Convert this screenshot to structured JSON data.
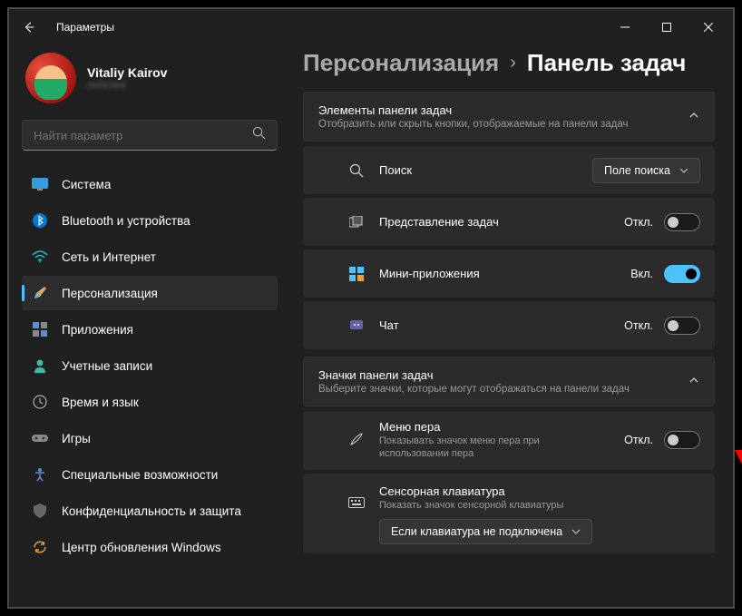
{
  "window": {
    "title": "Параметры"
  },
  "user": {
    "name": "Vitaliy Kairov",
    "email": "redacted"
  },
  "search": {
    "placeholder": "Найти параметр"
  },
  "nav": [
    {
      "label": "Система"
    },
    {
      "label": "Bluetooth и устройства"
    },
    {
      "label": "Сеть и Интернет"
    },
    {
      "label": "Персонализация"
    },
    {
      "label": "Приложения"
    },
    {
      "label": "Учетные записи"
    },
    {
      "label": "Время и язык"
    },
    {
      "label": "Игры"
    },
    {
      "label": "Специальные возможности"
    },
    {
      "label": "Конфиденциальность и защита"
    },
    {
      "label": "Центр обновления Windows"
    }
  ],
  "crumb": {
    "parent": "Персонализация",
    "sep": "›",
    "current": "Панель задач"
  },
  "sec1": {
    "title": "Элементы панели задач",
    "sub": "Отобразить или скрыть кнопки, отображаемые на панели задач",
    "rows": {
      "search": {
        "label": "Поиск",
        "dd": "Поле поиска"
      },
      "taskview": {
        "label": "Представление задач",
        "state": "Откл."
      },
      "widgets": {
        "label": "Мини-приложения",
        "state": "Вкл."
      },
      "chat": {
        "label": "Чат",
        "state": "Откл."
      }
    }
  },
  "sec2": {
    "title": "Значки панели задач",
    "sub": "Выберите значки, которые могут отображаться на панели задач",
    "rows": {
      "pen": {
        "label": "Меню пера",
        "sub": "Показывать значок меню пера при использовании пера",
        "state": "Откл."
      },
      "kb": {
        "label": "Сенсорная клавиатура",
        "sub": "Показать значок сенсорной клавиатуры",
        "dd": "Если клавиатура не подключена"
      }
    }
  }
}
